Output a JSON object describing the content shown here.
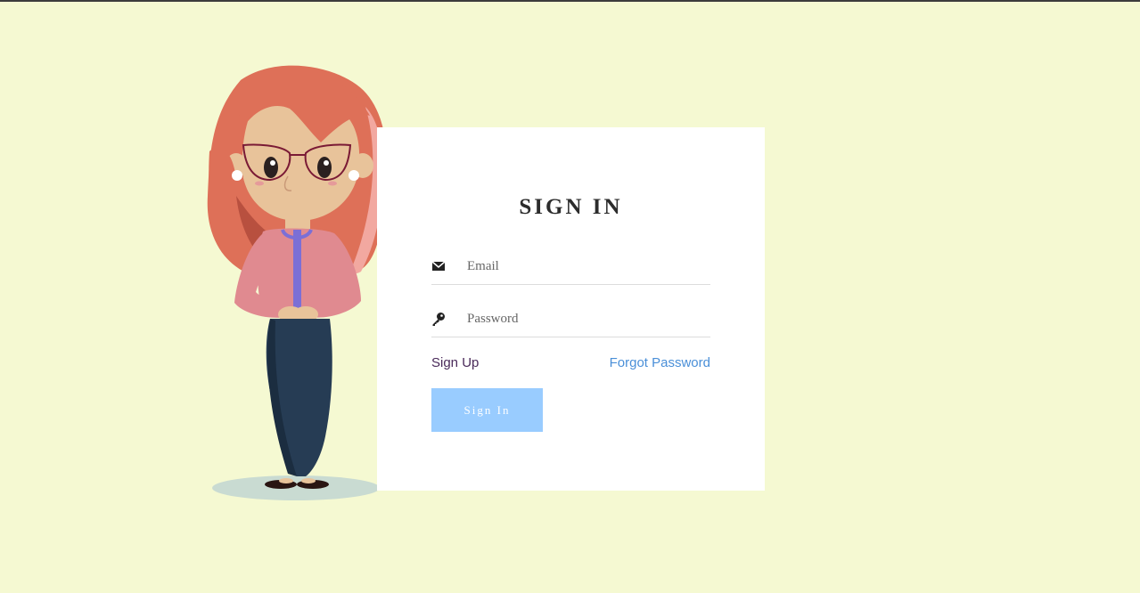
{
  "form": {
    "title": "SIGN IN",
    "email": {
      "placeholder": "Email",
      "value": "",
      "icon": "envelope-icon"
    },
    "password": {
      "placeholder": "Password",
      "value": "",
      "icon": "key-icon"
    },
    "signup_label": "Sign Up",
    "forgot_label": "Forgot Password",
    "submit_label": "Sign In"
  },
  "colors": {
    "background": "#f5f9d2",
    "card": "#ffffff",
    "button": "#99ccff",
    "link_forgot": "#4a8fd8",
    "link_signup": "#4a2a5a"
  },
  "illustration": {
    "icon": "woman-with-glasses-illustration"
  }
}
